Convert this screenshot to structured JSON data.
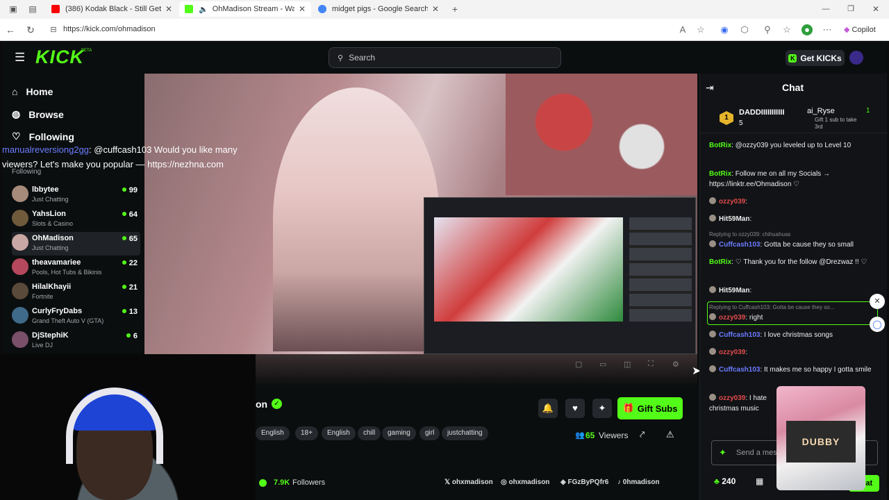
{
  "browser": {
    "tabs": [
      {
        "title": "(386) Kodak Black - Still Get Charg",
        "active": false
      },
      {
        "title": "OhMadison Stream - Watch",
        "active": true
      },
      {
        "title": "midget pigs - Google Search",
        "active": false
      }
    ],
    "url": "https://kick.com/ohmadison",
    "copilot_label": "Copilot"
  },
  "header": {
    "logo": "KICK",
    "logo_beta": "BETA",
    "search_placeholder": "Search",
    "get_kicks_label": "Get KICKs"
  },
  "sidebar": {
    "nav": [
      {
        "label": "Home",
        "icon": "home-icon"
      },
      {
        "label": "Browse",
        "icon": "compass-icon"
      },
      {
        "label": "Following",
        "icon": "heart-icon"
      }
    ],
    "following_header": "Following",
    "channels": [
      {
        "name": "lbbytee",
        "category": "Just Chatting",
        "viewers": "99"
      },
      {
        "name": "YahsLion",
        "category": "Slots & Casino",
        "viewers": "64"
      },
      {
        "name": "OhMadison",
        "category": "Just Chatting",
        "viewers": "65"
      },
      {
        "name": "theavamariee",
        "category": "Pools, Hot Tubs & Bikinis",
        "viewers": "22"
      },
      {
        "name": "HilalKhayii",
        "category": "Fortnite",
        "viewers": "21"
      },
      {
        "name": "CurlyFryDabs",
        "category": "Grand Theft Auto V (GTA)",
        "viewers": "13"
      },
      {
        "name": "DjStephiK",
        "category": "Live DJ",
        "viewers": "6"
      }
    ]
  },
  "overlay_message": {
    "user": "manualreversiong2gg",
    "text": ": @cuffcash103 Would you like many viewers? Let's make you popular — https://nezhna.com"
  },
  "stream": {
    "channel_name_partial": "on",
    "gift_subs_label": "Gift Subs",
    "tags": [
      "English",
      "18+",
      "English",
      "chill",
      "gaming",
      "girl",
      "justchatting"
    ],
    "viewers_count": "65",
    "viewers_label": "Viewers",
    "followers_count": "7.9K",
    "followers_label": "Followers",
    "socials": [
      "ohxmadison",
      "ohxmadison",
      "FGzByPQfr6",
      "0hmadison"
    ]
  },
  "chat": {
    "title": "Chat",
    "pinned_top": {
      "rank": "1",
      "name": "DADDIIIIIIIIIII",
      "count": "5",
      "second": "ai_Ryse",
      "second_note": "Gift 1 sub to take 3rd",
      "second_count": "1"
    },
    "messages": [
      {
        "user": "BotRix",
        "text": ": @ozzy039 you leveled up to Level 10"
      },
      {
        "user": "BotRix",
        "text": ": Follow me on all my Socials → https://linktr.ee/Ohmadison ♡"
      },
      {
        "user": "ozzy039",
        "text": ":"
      },
      {
        "user": "Hit59Man",
        "text": ":"
      },
      {
        "reply": "Replying to ozzy039: chihuahuas",
        "user": "Cuffcash103",
        "text": ": Gotta be cause they so small"
      },
      {
        "user": "BotRix",
        "text": ": ♡ Thank you for the follow @Drezwaz !! ♡"
      },
      {
        "user": "Hit59Man",
        "text": ":"
      },
      {
        "reply": "Replying to Cuffcash103: Gotta be cause they so...",
        "user": "ozzy039",
        "text": ": right"
      },
      {
        "user": "Cuffcash103",
        "text": ": I love christmas songs"
      },
      {
        "user": "ozzy039",
        "text": ":"
      },
      {
        "user": "Cuffcash103",
        "text": ": It makes me so happy I gotta smile"
      },
      {
        "user": "ozzy039",
        "text": ": I hate christmas music"
      }
    ],
    "input_placeholder": "Send a message",
    "points": "240",
    "send_label": "Chat"
  },
  "overlay_product": {
    "brand": "DUBBY"
  },
  "colors": {
    "kick_green": "#53fc18",
    "bg": "#0b0e0f",
    "username_blue": "#6c7cff",
    "username_red": "#e24b4b"
  }
}
